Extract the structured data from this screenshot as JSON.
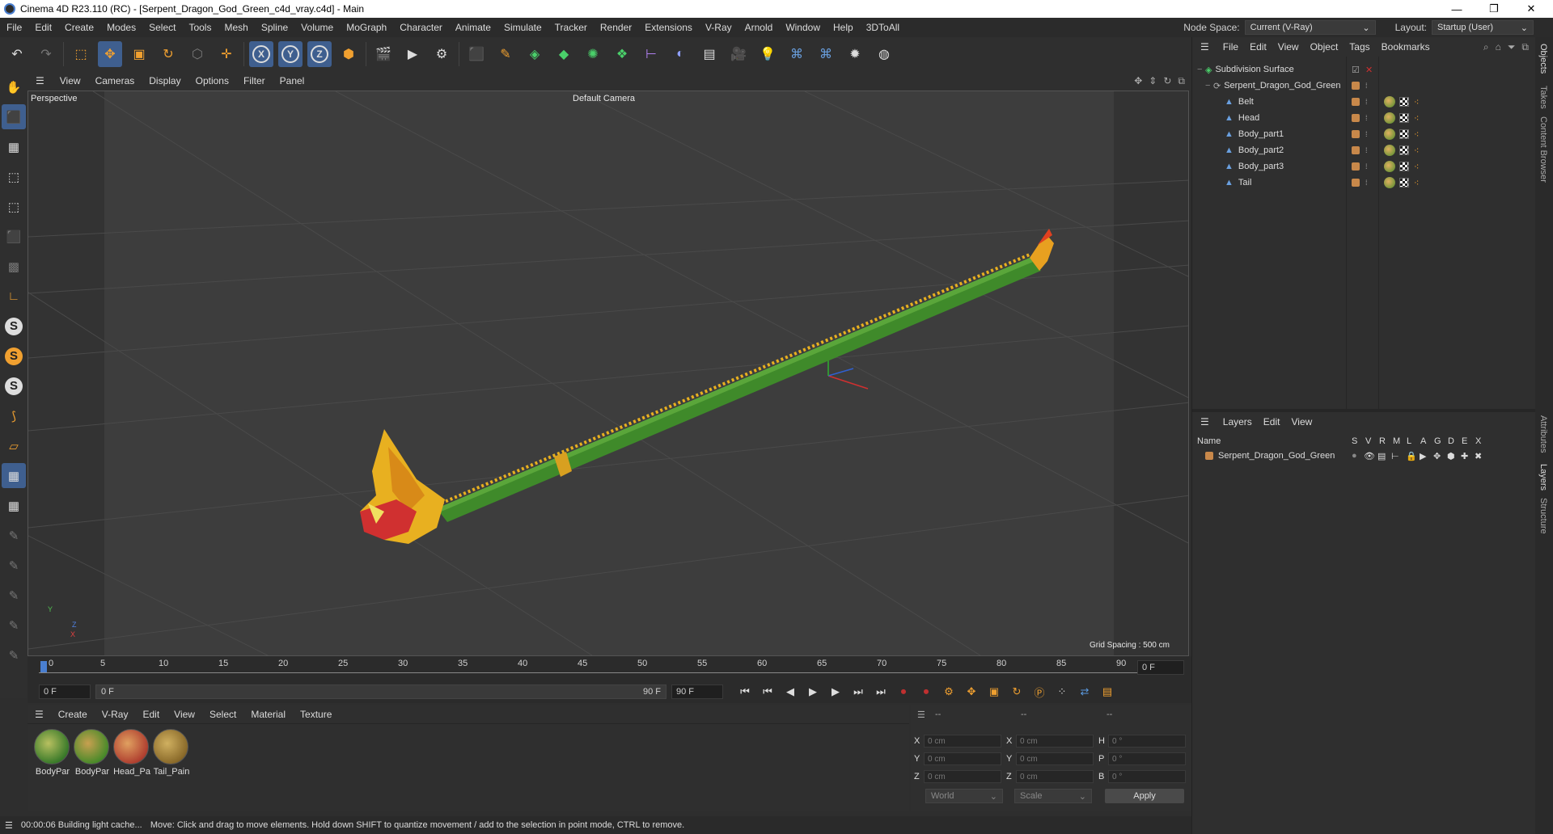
{
  "window": {
    "title": "Cinema 4D R23.110 (RC) - [Serpent_Dragon_God_Green_c4d_vray.c4d] - Main",
    "minimize": "—",
    "maximize": "❐",
    "close": "✕"
  },
  "menubar": {
    "items": [
      "File",
      "Edit",
      "Create",
      "Modes",
      "Select",
      "Tools",
      "Mesh",
      "Spline",
      "Volume",
      "MoGraph",
      "Character",
      "Animate",
      "Simulate",
      "Tracker",
      "Render",
      "Extensions",
      "V-Ray",
      "Arnold",
      "Window",
      "Help",
      "3DToAll"
    ],
    "node_space_label": "Node Space:",
    "node_space_value": "Current (V-Ray)",
    "layout_label": "Layout:",
    "layout_value": "Startup (User)"
  },
  "toolbar": {
    "axis_x": "X",
    "axis_y": "Y",
    "axis_z": "Z"
  },
  "viewport": {
    "menu": [
      "View",
      "Cameras",
      "Display",
      "Options",
      "Filter",
      "Panel"
    ],
    "view_name": "Perspective",
    "camera": "Default Camera",
    "grid_spacing": "Grid Spacing : 500 cm",
    "axis_labels": [
      "Y",
      "Z",
      "X"
    ]
  },
  "timeline": {
    "ticks": [
      "0",
      "5",
      "10",
      "15",
      "20",
      "25",
      "30",
      "35",
      "40",
      "45",
      "50",
      "55",
      "60",
      "65",
      "70",
      "75",
      "80",
      "85",
      "90"
    ],
    "current_frame": "0 F"
  },
  "playbar": {
    "start": "0 F",
    "range_start": "0 F",
    "range_end": "90 F",
    "end": "90 F"
  },
  "materials": {
    "menu": [
      "Create",
      "V-Ray",
      "Edit",
      "View",
      "Select",
      "Material",
      "Texture"
    ],
    "items": [
      "BodyPar",
      "BodyPar",
      "Head_Pa",
      "Tail_Pain"
    ]
  },
  "coordinates": {
    "headers": [
      "--",
      "--",
      "--"
    ],
    "rows": [
      {
        "l1": "X",
        "v1": "0 cm",
        "l2": "X",
        "v2": "0 cm",
        "l3": "H",
        "v3": "0 °"
      },
      {
        "l1": "Y",
        "v1": "0 cm",
        "l2": "Y",
        "v2": "0 cm",
        "l3": "P",
        "v3": "0 °"
      },
      {
        "l1": "Z",
        "v1": "0 cm",
        "l2": "Z",
        "v2": "0 cm",
        "l3": "B",
        "v3": "0 °"
      }
    ],
    "mode": "World",
    "scale": "Scale",
    "apply": "Apply"
  },
  "status": {
    "time": "00:00:06 Building light cache...",
    "message": "Move: Click and drag to move elements. Hold down SHIFT to quantize movement / add to the selection in point mode, CTRL to remove."
  },
  "objects": {
    "menu": [
      "File",
      "Edit",
      "View",
      "Object",
      "Tags",
      "Bookmarks"
    ],
    "items": [
      {
        "name": "Subdivision Surface",
        "level": 0
      },
      {
        "name": "Serpent_Dragon_God_Green",
        "level": 1
      },
      {
        "name": "Belt",
        "level": 2
      },
      {
        "name": "Head",
        "level": 2
      },
      {
        "name": "Body_part1",
        "level": 2
      },
      {
        "name": "Body_part2",
        "level": 2
      },
      {
        "name": "Body_part3",
        "level": 2
      },
      {
        "name": "Tail",
        "level": 2
      }
    ]
  },
  "layers": {
    "menu": [
      "Layers",
      "Edit",
      "View"
    ],
    "col_name": "Name",
    "cols": [
      "S",
      "V",
      "R",
      "M",
      "L",
      "A",
      "G",
      "D",
      "E",
      "X"
    ],
    "items": [
      "Serpent_Dragon_God_Green"
    ]
  },
  "side_tabs": [
    "Objects",
    "Takes",
    "Content Browser",
    "Attributes",
    "Layers",
    "Structure"
  ]
}
